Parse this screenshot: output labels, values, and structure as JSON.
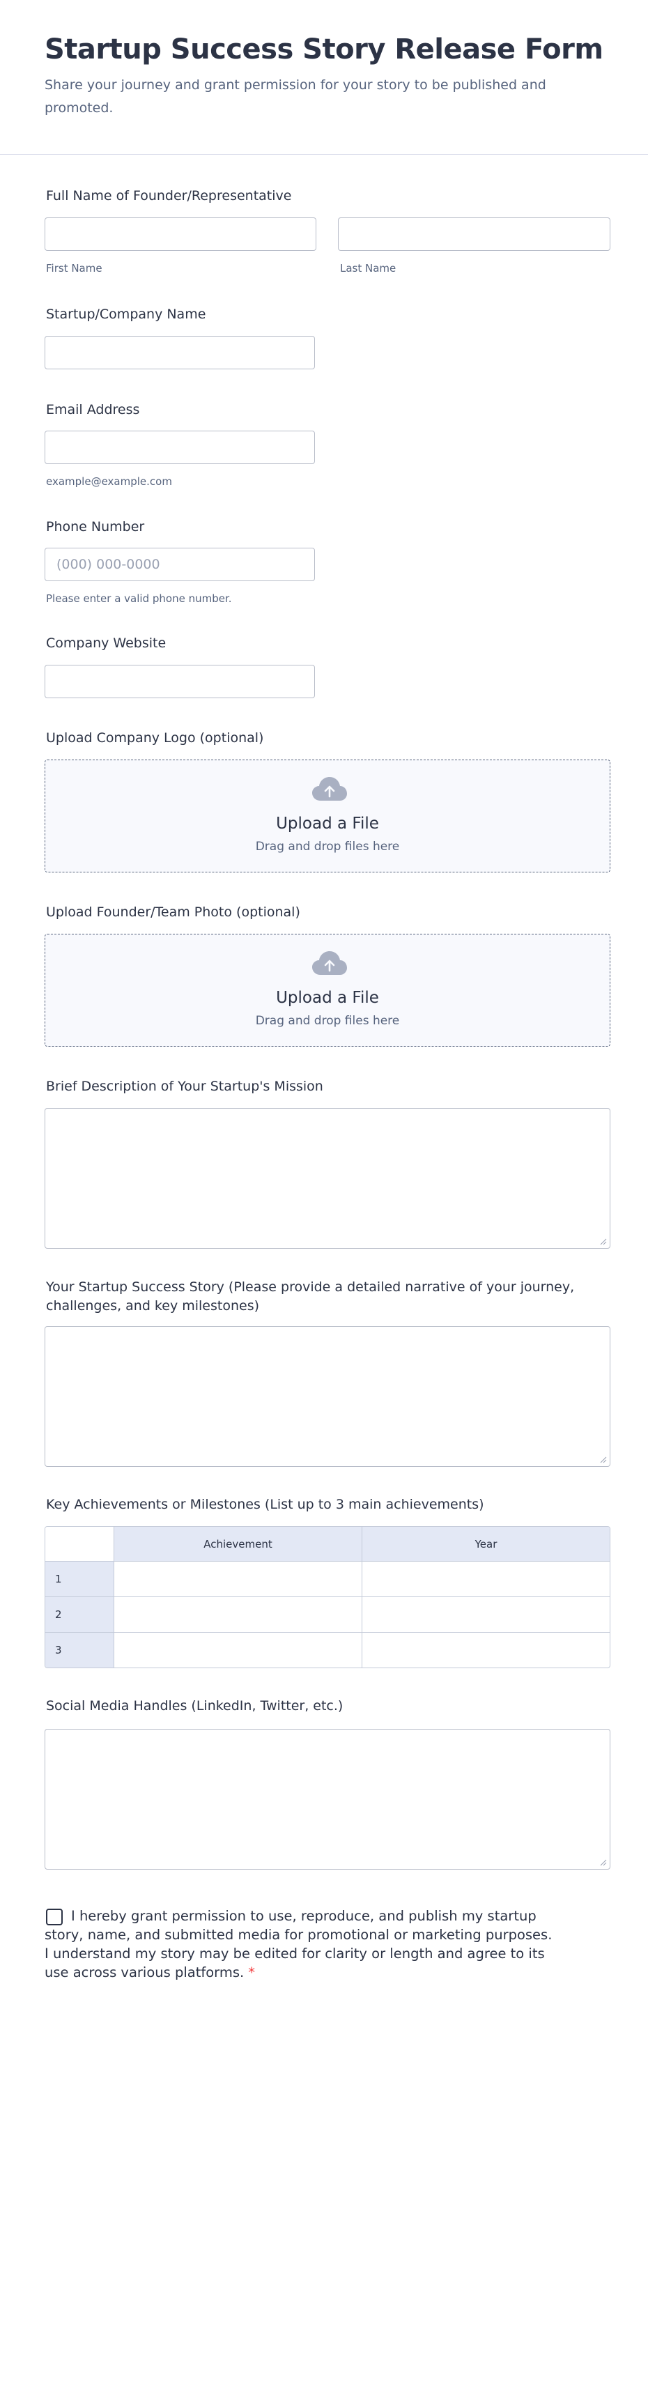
{
  "form": {
    "title": "Startup Success Story Release Form",
    "subtitle": "Share your journey and grant permission for your story to be published and promoted."
  },
  "fields": {
    "full_name": {
      "label": "Full Name of Founder/Representative",
      "first_sublabel": "First Name",
      "last_sublabel": "Last Name"
    },
    "company_name": {
      "label": "Startup/Company Name"
    },
    "email": {
      "label": "Email Address",
      "sublabel": "example@example.com"
    },
    "phone": {
      "label": "Phone Number",
      "placeholder": "(000) 000-0000",
      "sublabel": "Please enter a valid phone number."
    },
    "website": {
      "label": "Company Website"
    },
    "logo_upload": {
      "label": "Upload Company Logo (optional)",
      "title": "Upload a File",
      "hint": "Drag and drop files here"
    },
    "photo_upload": {
      "label": "Upload Founder/Team Photo (optional)",
      "title": "Upload a File",
      "hint": "Drag and drop files here"
    },
    "mission": {
      "label": "Brief Description of Your Startup's Mission"
    },
    "story": {
      "label": "Your Startup Success Story (Please provide a detailed narrative of your journey, challenges, and key milestones)"
    },
    "achievements": {
      "label": "Key Achievements or Milestones (List up to 3 main achievements)",
      "columns": [
        "Achievement",
        "Year"
      ],
      "rows": [
        "1",
        "2",
        "3"
      ]
    },
    "social": {
      "label": "Social Media Handles (LinkedIn, Twitter, etc.)"
    },
    "consent": {
      "text": "I hereby grant permission to use, reproduce, and publish my startup story, name, and submitted media for promotional or marketing purposes. I understand my story may be edited for clarity or length and agree to its use across various platforms.",
      "required_mark": "*"
    }
  },
  "colors": {
    "text": "#2c3345",
    "muted": "#57647e",
    "border": "#b8bdc9",
    "upload_bg": "#f8f9fd",
    "table_header_bg": "#e3e8f5",
    "required": "#f23a3c",
    "cloud_icon": "#a9b0c2"
  },
  "icons": {
    "upload": "cloud-upload-icon",
    "resize": "resize-grip-icon"
  }
}
